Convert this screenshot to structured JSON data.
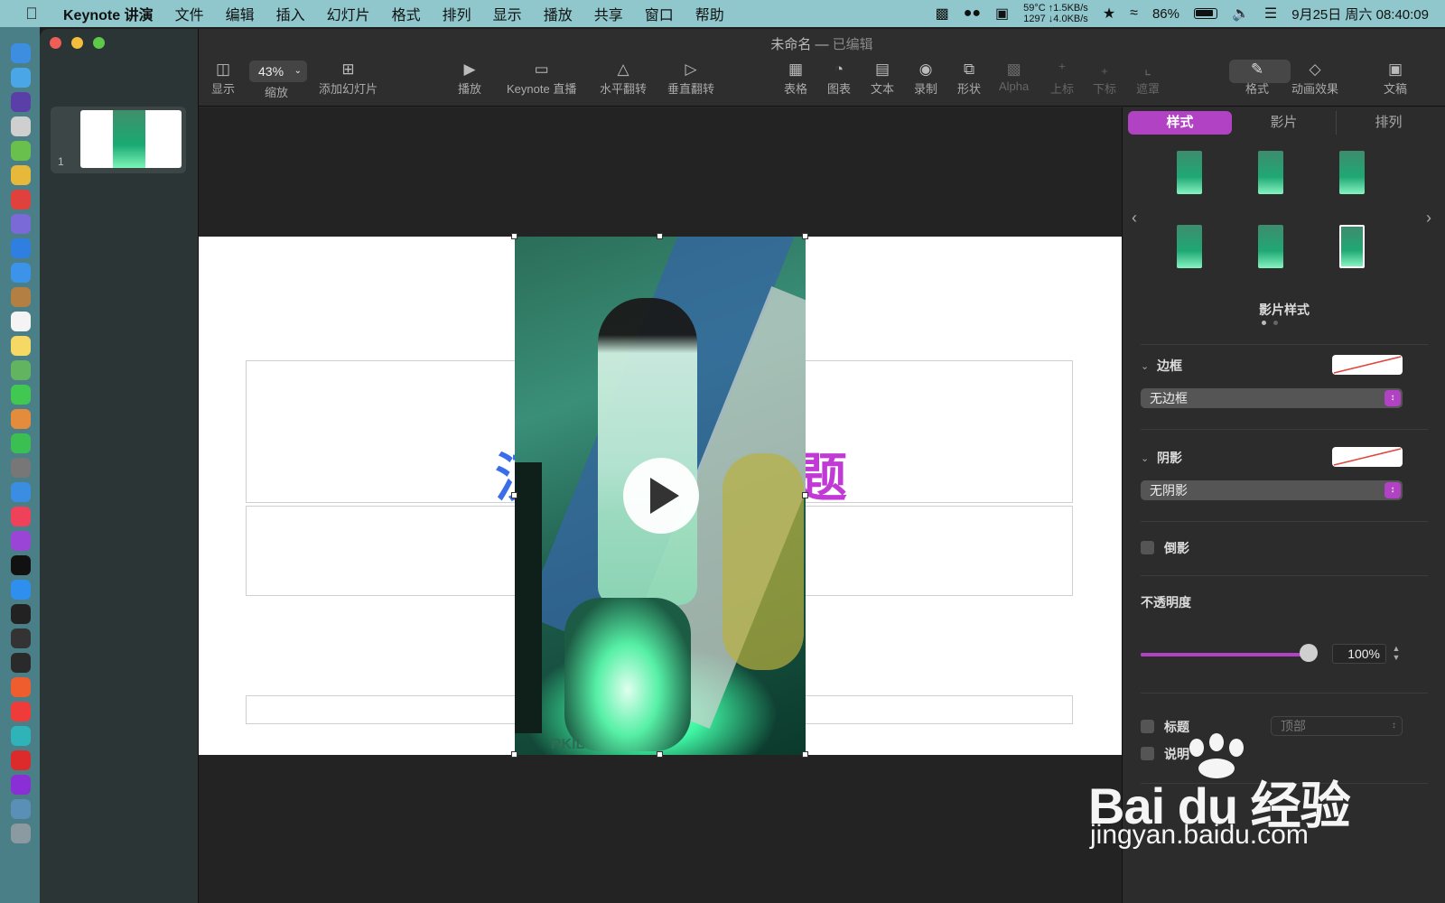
{
  "menubar": {
    "app_name": "Keynote 讲演",
    "menus": [
      "文件",
      "编辑",
      "插入",
      "幻灯片",
      "格式",
      "排列",
      "显示",
      "播放",
      "共享",
      "窗口",
      "帮助"
    ],
    "stats_line1": "59°C ↑1.5KB/s",
    "stats_line2": "1297 ↓4.0KB/s",
    "battery": "86%",
    "datetime": "9月25日 周六  08:40:09"
  },
  "window": {
    "title": "未命名",
    "title_sep": " — ",
    "status": "已编辑"
  },
  "sidebar": {
    "slide_number": "1"
  },
  "toolbar": {
    "view": "显示",
    "zoom_value": "43%",
    "zoom": "缩放",
    "add_slide": "添加幻灯片",
    "play": "播放",
    "keynote_live": "Keynote 直播",
    "flip_h": "水平翻转",
    "flip_v": "垂直翻转",
    "table": "表格",
    "chart": "图表",
    "text": "文本",
    "record": "录制",
    "shape": "形状",
    "alpha": "Alpha",
    "superscript": "上标",
    "subscript": "下标",
    "mask": "遮罩",
    "format": "格式",
    "animate": "动画效果",
    "document": "文稿"
  },
  "slide": {
    "title_left_char": "汉",
    "title_right_char": "题",
    "video_watermark": "RKIL"
  },
  "inspector": {
    "tabs": [
      "样式",
      "影片",
      "排列"
    ],
    "styles_label": "影片样式",
    "border_label": "边框",
    "border_value": "无边框",
    "shadow_label": "阴影",
    "shadow_value": "无阴影",
    "reflection_label": "倒影",
    "opacity_label": "不透明度",
    "opacity_value": "100%",
    "opacity_fraction": 1.0,
    "title_label": "标题",
    "caption_label": "说明",
    "caption_position": "顶部"
  },
  "watermark": {
    "brand": "Bai du 经验",
    "url": "jingyan.baidu.com"
  },
  "colors": {
    "accent": "#b242c4",
    "menubar": "#8fc7cc",
    "title_left": "#3a6ee8",
    "title_right": "#c23ad6"
  }
}
